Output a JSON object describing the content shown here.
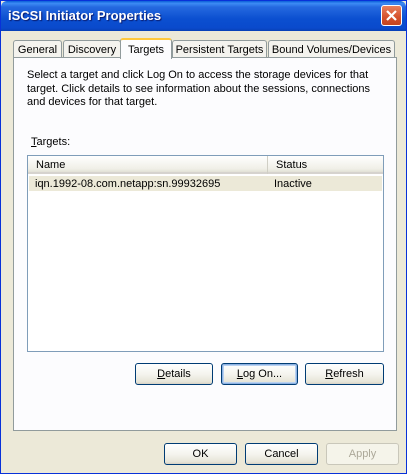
{
  "window": {
    "title": "iSCSI Initiator Properties"
  },
  "tabs": [
    {
      "label": "General"
    },
    {
      "label": "Discovery"
    },
    {
      "label": "Targets"
    },
    {
      "label": "Persistent Targets"
    },
    {
      "label": "Bound Volumes/Devices"
    }
  ],
  "active_tab": "Targets",
  "description": "Select a target and click Log On to access the storage devices for that target. Click details to see information about the sessions, connections and devices for that target.",
  "targets": {
    "label_mnemonic": "T",
    "label_rest": "argets:",
    "columns": {
      "name": "Name",
      "status": "Status"
    },
    "rows": [
      {
        "name": "iqn.1992-08.com.netapp:sn.99932695",
        "status": "Inactive"
      }
    ]
  },
  "panel_buttons": {
    "details": {
      "mnemonic": "D",
      "rest": "etails"
    },
    "logon": {
      "mnemonic": "L",
      "rest": "og On..."
    },
    "refresh": {
      "mnemonic": "R",
      "rest": "efresh"
    }
  },
  "dialog_buttons": {
    "ok": "OK",
    "cancel": "Cancel",
    "apply": "Apply"
  },
  "colors": {
    "titlebar": "#0a4acc",
    "accent_tab": "#ffc83c",
    "selection": "#ece9d8"
  },
  "icons": {
    "close": "close-icon"
  }
}
